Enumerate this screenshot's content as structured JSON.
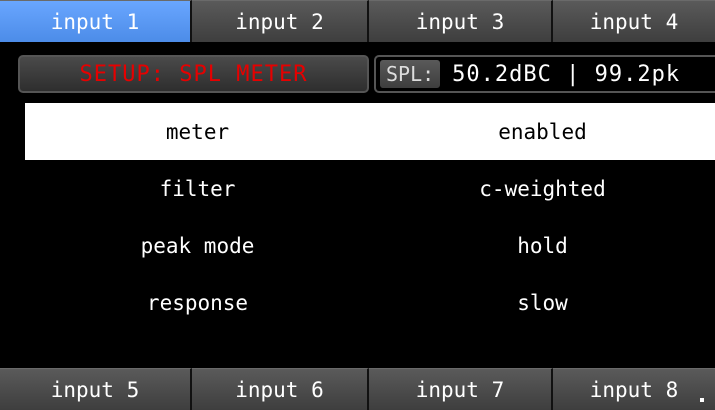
{
  "tabs_top": [
    "input 1",
    "input 2",
    "input 3",
    "input 4"
  ],
  "tabs_bottom": [
    "input 5",
    "input 6",
    "input 7",
    "input 8"
  ],
  "active_tab": "input 1",
  "setup_title": "SETUP: SPL METER",
  "spl": {
    "label": "SPL:",
    "value": "50.2dBC | 99.2pk"
  },
  "settings": [
    {
      "name": "meter",
      "value": "enabled"
    },
    {
      "name": "filter",
      "value": "c-weighted"
    },
    {
      "name": "peak mode",
      "value": "hold"
    },
    {
      "name": "response",
      "value": "slow"
    }
  ],
  "colors": {
    "active_tab": "#5b9bf7",
    "tab": "#4a4a4a",
    "setup_title": "#e60000",
    "background": "#000000",
    "selected_row": "#ffffff"
  }
}
